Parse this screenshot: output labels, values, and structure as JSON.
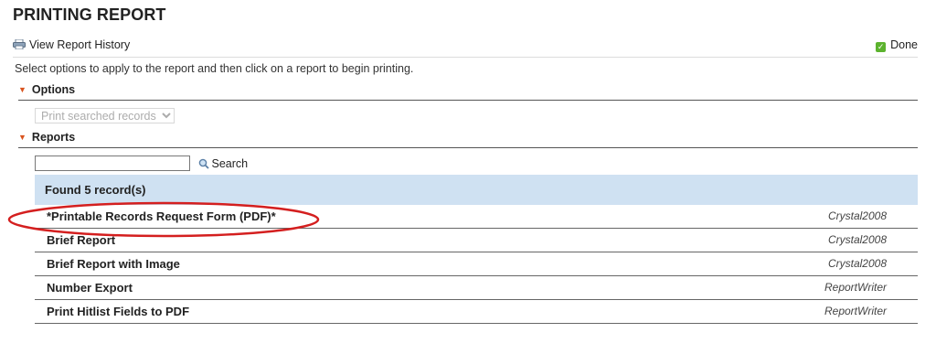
{
  "page": {
    "title": "PRINTING REPORT"
  },
  "toolbar": {
    "history_label": "View Report History",
    "history_icon": "printer-icon",
    "done_label": "Done",
    "done_icon": "checkmark-icon",
    "done_color": "#5cb32e"
  },
  "instructions": "Select options to apply to the report and then click on a report to begin printing.",
  "options": {
    "header": "Options",
    "record_select": {
      "value": "Print searched records",
      "options": [
        "Print searched records"
      ]
    }
  },
  "reports": {
    "header": "Reports",
    "search": {
      "button_label": "Search",
      "value": "",
      "icon": "magnifier-icon"
    },
    "found_label": "Found 5 record(s)",
    "items": [
      {
        "name": "*Printable Records Request Form (PDF)*",
        "engine": "Crystal2008"
      },
      {
        "name": "Brief Report",
        "engine": "Crystal2008"
      },
      {
        "name": "Brief Report with Image",
        "engine": "Crystal2008"
      },
      {
        "name": "Number Export",
        "engine": "ReportWriter"
      },
      {
        "name": "Print Hitlist Fields to PDF",
        "engine": "ReportWriter"
      }
    ]
  },
  "colors": {
    "accent_caret": "#d9531e",
    "results_header_bg": "#cfe1f2",
    "annotation": "#d41f1f"
  }
}
